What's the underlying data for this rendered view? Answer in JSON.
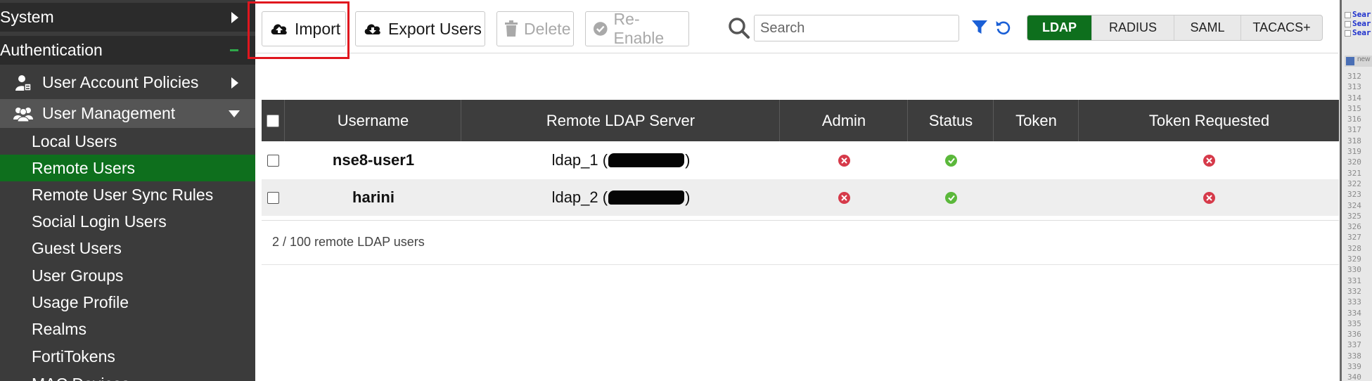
{
  "sidebar": {
    "items": [
      {
        "label": "System"
      },
      {
        "label": "Authentication"
      },
      {
        "label": "User Account Policies"
      },
      {
        "label": "User Management"
      },
      {
        "label": "Local Users"
      },
      {
        "label": "Remote Users"
      },
      {
        "label": "Remote User Sync Rules"
      },
      {
        "label": "Social Login Users"
      },
      {
        "label": "Guest Users"
      },
      {
        "label": "User Groups"
      },
      {
        "label": "Usage Profile"
      },
      {
        "label": "Realms"
      },
      {
        "label": "FortiTokens"
      },
      {
        "label": "MAC Devices"
      }
    ],
    "active_item": "Remote Users",
    "active_color": "#0e6f1d"
  },
  "toolbar": {
    "import_label": "Import",
    "export_label": "Export Users",
    "delete_label": "Delete",
    "reenable_label": "Re-Enable",
    "highlight_color": "#e0161e"
  },
  "search": {
    "placeholder": "Search",
    "value": ""
  },
  "auth_tabs": [
    {
      "label": "LDAP",
      "active": true
    },
    {
      "label": "RADIUS",
      "active": false
    },
    {
      "label": "SAML",
      "active": false
    },
    {
      "label": "TACACS+",
      "active": false
    }
  ],
  "table": {
    "columns": [
      "Username",
      "Remote LDAP Server",
      "Admin",
      "Status",
      "Token",
      "Token Requested"
    ],
    "rows": [
      {
        "username": "nse8-user1",
        "server_prefix": "ldap_1 (",
        "server_suffix": ")",
        "admin": "no",
        "status": "ok",
        "token": "",
        "token_requested": "no"
      },
      {
        "username": "harini",
        "server_prefix": "ldap_2 (",
        "server_suffix": ")",
        "admin": "no",
        "status": "ok",
        "token": "",
        "token_requested": "no"
      }
    ]
  },
  "footer": {
    "count_text": "2 / 100 remote LDAP users"
  },
  "edge_panel": {
    "links": [
      "Sear",
      "Sear",
      "Sear"
    ],
    "new_label": "new",
    "line_numbers": [
      "312",
      "313",
      "314",
      "315",
      "316",
      "317",
      "318",
      "319",
      "320",
      "321",
      "322",
      "323",
      "324",
      "325",
      "326",
      "327",
      "328",
      "329",
      "330",
      "331",
      "332",
      "333",
      "334",
      "335",
      "336",
      "337",
      "338",
      "339",
      "340"
    ]
  },
  "icons": {
    "cloud_upload": "cloud-upload-icon",
    "cloud_download": "cloud-download-icon",
    "trash": "trash-icon",
    "check_circle": "check-circle-icon",
    "search": "search-icon",
    "filter": "filter-icon",
    "reset": "reset-icon",
    "user_policy": "user-policy-icon",
    "users": "users-icon",
    "status_red": "#d63a4a",
    "status_green": "#5bb83b",
    "accent_blue": "#1a5fd6"
  }
}
